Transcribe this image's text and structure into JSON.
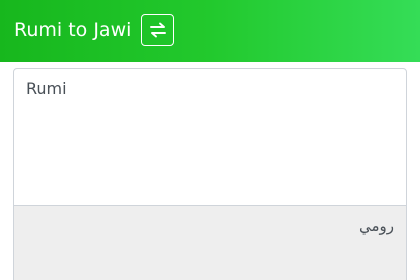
{
  "header": {
    "title": "Rumi to Jawi",
    "swap_icon": "swap-arrows-icon"
  },
  "input": {
    "value": "",
    "placeholder": "Rumi"
  },
  "output": {
    "text": "رومي"
  },
  "colors": {
    "header_start": "#17b71d",
    "header_end": "#35dd57",
    "output_background": "#eeeeee"
  }
}
